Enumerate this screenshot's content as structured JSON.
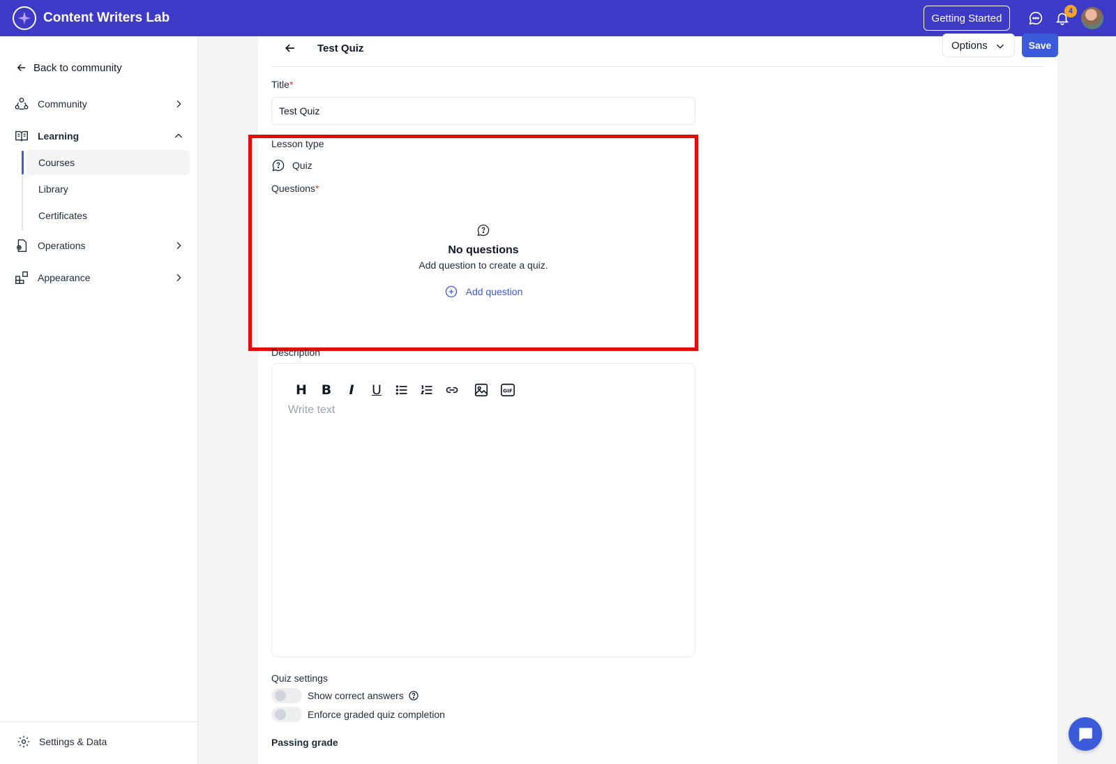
{
  "topbar": {
    "brand_name": "Content Writers Lab",
    "getting_started_label": "Getting Started",
    "notification_count": "4",
    "accent_color": "#3d3ac7"
  },
  "sidebar": {
    "back_label": "Back to community",
    "items": [
      {
        "label": "Community",
        "icon": "community-icon"
      },
      {
        "label": "Learning",
        "icon": "book-icon"
      },
      {
        "label": "Operations",
        "icon": "operations-icon"
      },
      {
        "label": "Appearance",
        "icon": "appearance-icon"
      }
    ],
    "learning_sub": [
      {
        "label": "Courses",
        "active": true
      },
      {
        "label": "Library"
      },
      {
        "label": "Certificates"
      }
    ],
    "settings_label": "Settings & Data"
  },
  "header": {
    "title": "Test Quiz",
    "options_label": "Options",
    "save_label": "Save",
    "primary_color": "#3b5bdb"
  },
  "form": {
    "title_label": "Title",
    "title_value": "Test Quiz",
    "required_mark": "*",
    "lesson_type_label": "Lesson type",
    "lesson_type_value": "Quiz",
    "questions_label": "Questions",
    "empty_title": "No questions",
    "empty_subtitle": "Add question to create a quiz.",
    "add_question_label": "Add question",
    "description_label": "Description",
    "editor_placeholder": "Write text",
    "toolbar": [
      "H",
      "B",
      "I",
      "U"
    ],
    "quiz_settings_label": "Quiz settings",
    "show_correct_answers_label": "Show correct answers",
    "enforce_graded_label": "Enforce graded quiz completion",
    "passing_grade_label": "Passing grade",
    "highlight_color": "#e00d0d"
  }
}
